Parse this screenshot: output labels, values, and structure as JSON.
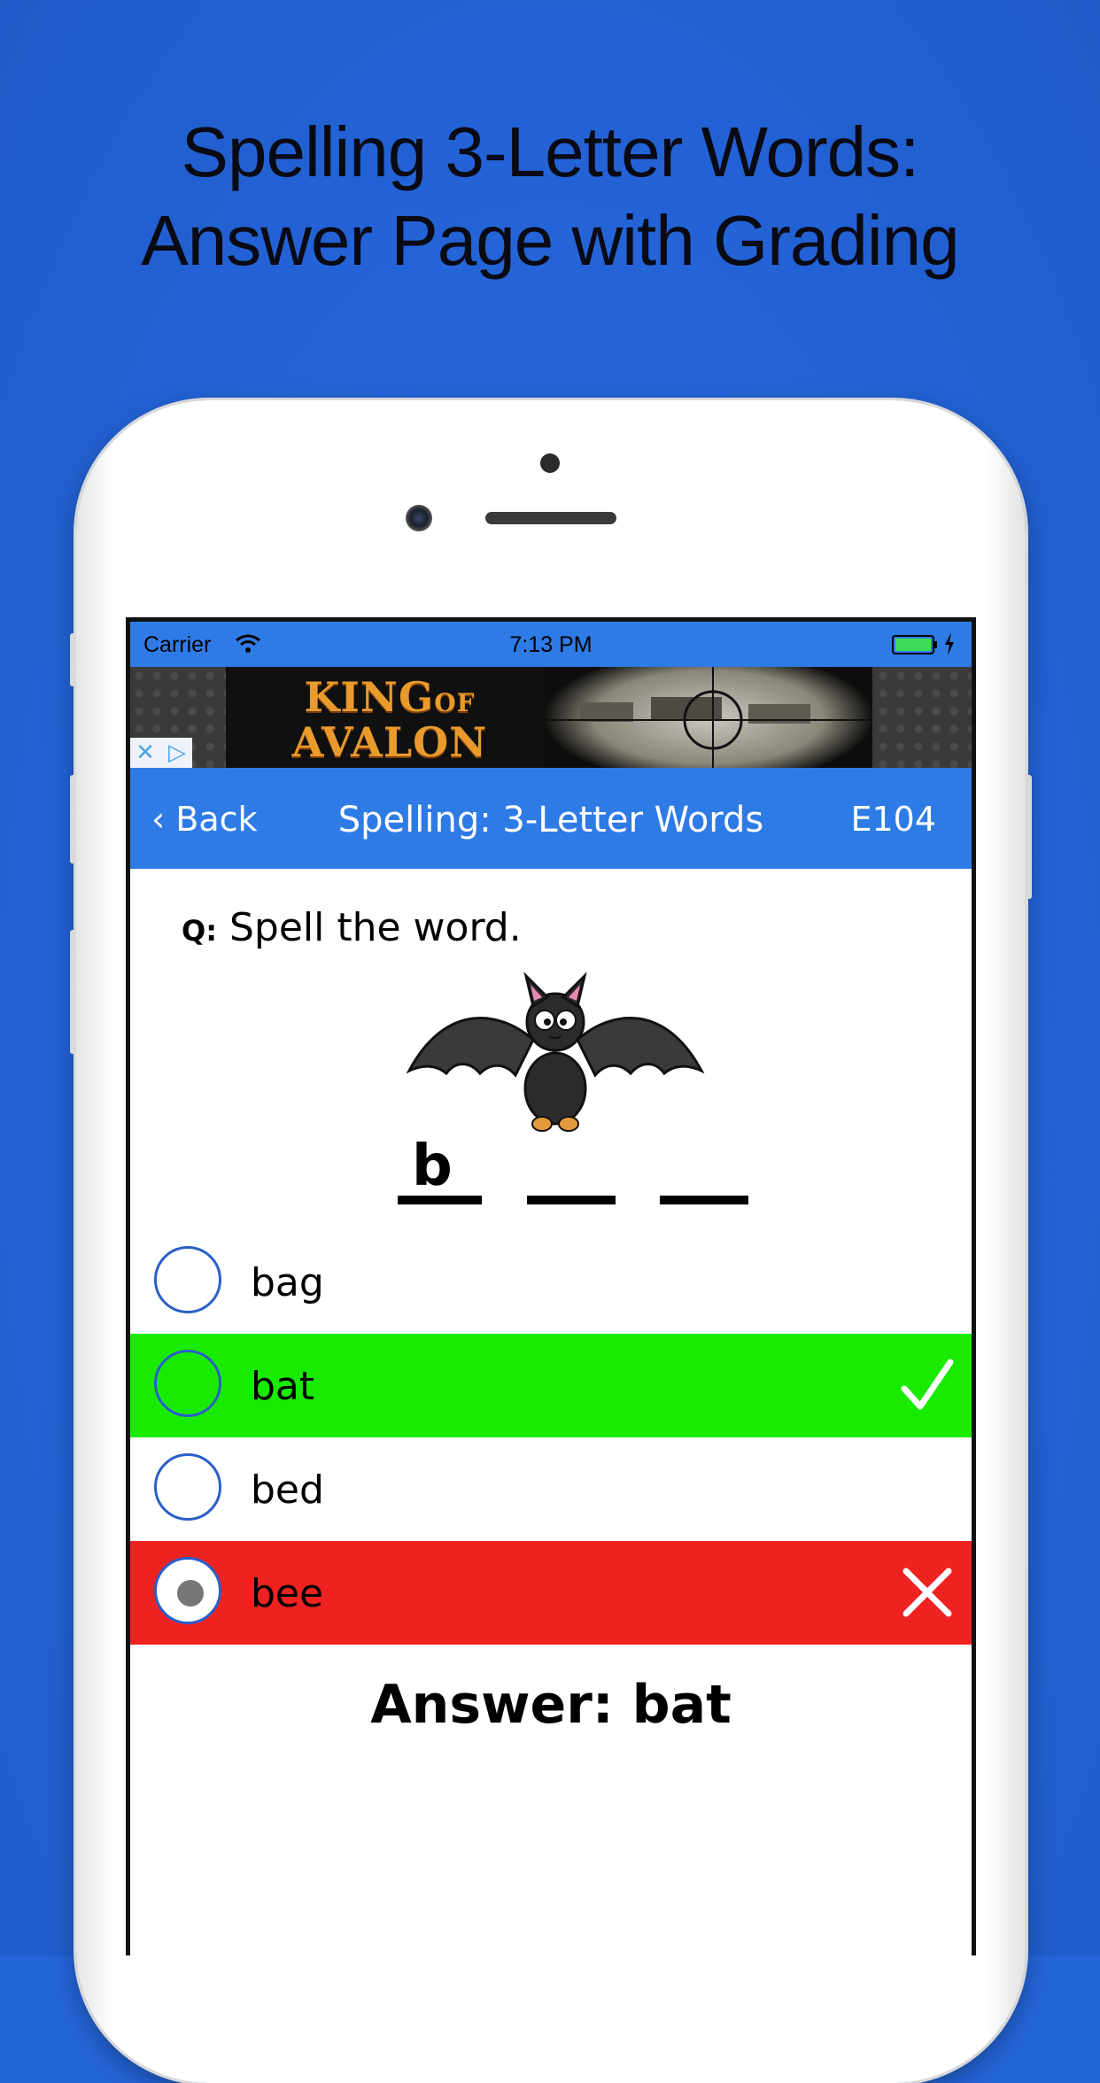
{
  "marketing": {
    "title_line1": "Spelling 3-Letter Words:",
    "title_line2": "Answer Page with Grading"
  },
  "status_bar": {
    "carrier": "Carrier",
    "time": "7:13 PM"
  },
  "ad": {
    "logo_line1": "KING",
    "logo_of": "OF",
    "logo_line2": "AVALON",
    "choices_close": "✕",
    "choices_info": "▷"
  },
  "nav": {
    "back_label": "‹ Back",
    "title": "Spelling: 3-Letter Words",
    "code": "E104"
  },
  "question": {
    "prefix": "Q:",
    "text": "Spell the word."
  },
  "puzzle": {
    "first_letter": "b"
  },
  "options": [
    {
      "label": "bag",
      "state": "none"
    },
    {
      "label": "bat",
      "state": "correct"
    },
    {
      "label": "bed",
      "state": "none"
    },
    {
      "label": "bee",
      "state": "wrong-selected"
    }
  ],
  "answer": {
    "text": "Answer: bat"
  },
  "colors": {
    "background": "#2465d9",
    "nav": "#2e7be6",
    "correct": "#19eb00",
    "wrong": "#ef2222"
  }
}
